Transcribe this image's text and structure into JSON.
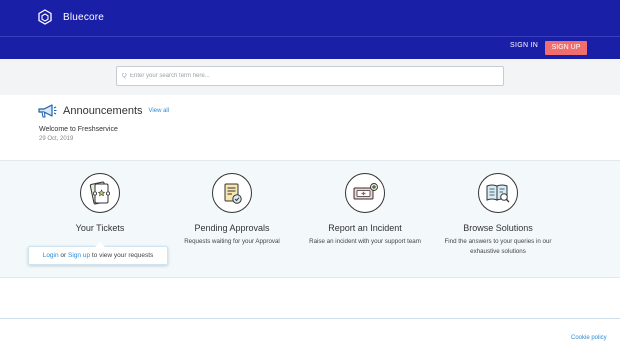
{
  "header": {
    "brand": "Bluecore",
    "logo_icon": "cube-logo-icon"
  },
  "auth": {
    "signin_label": "SIGN IN",
    "signup_label": "SIGN UP"
  },
  "search": {
    "placeholder": "Q  Enter your search term here...",
    "icon": "search-icon"
  },
  "announcements": {
    "title": "Announcements",
    "view_all": "View all",
    "item_title": "Welcome to Freshservice",
    "item_date": "29 Oct, 2019"
  },
  "cards": [
    {
      "title": "Your Tickets",
      "desc": "",
      "icon": "tickets-icon"
    },
    {
      "title": "Pending Approvals",
      "desc": "Requests waiting for your Approval",
      "icon": "approvals-icon"
    },
    {
      "title": "Report an Incident",
      "desc": "Raise an incident with your support team",
      "icon": "incident-icon"
    },
    {
      "title": "Browse Solutions",
      "desc": "Find the answers to your queries in our exhaustive solutions",
      "icon": "solutions-icon"
    }
  ],
  "tooltip": {
    "login": "Login",
    "or": " or ",
    "signup": "Sign up",
    "rest": " to view your requests"
  },
  "footer": {
    "cookie_policy": "Cookie policy"
  },
  "colors": {
    "header_bg": "#1a1fa8",
    "signup_bg": "#f06e6e",
    "link": "#2c8bd6",
    "cards_bg": "#f3f9fb"
  }
}
